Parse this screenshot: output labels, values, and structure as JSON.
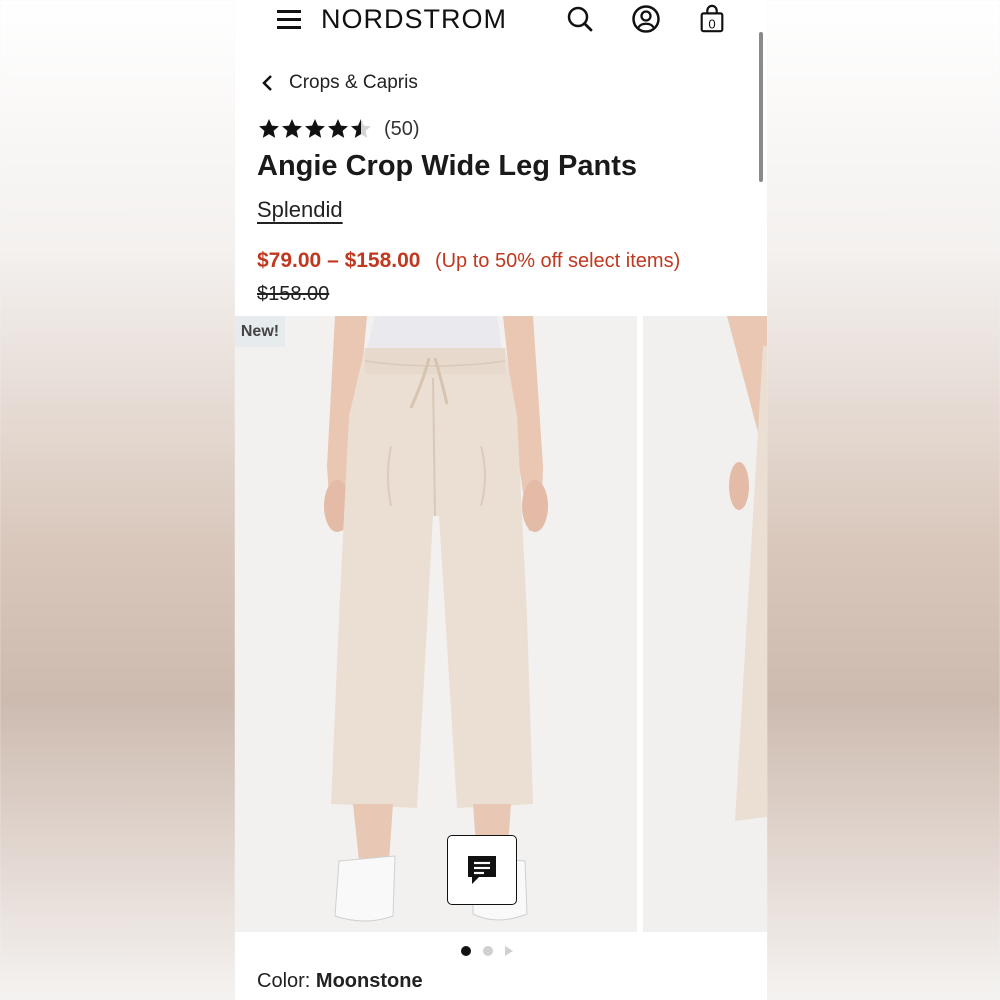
{
  "header": {
    "logo": "NORDSTROM",
    "menu_icon": "hamburger-menu-icon",
    "search_icon": "search-icon",
    "account_icon": "account-icon",
    "bag_icon": "shopping-bag-icon",
    "bag_count": "0"
  },
  "breadcrumb": {
    "label": "Crops & Capris",
    "icon": "chevron-left-icon"
  },
  "rating": {
    "stars": 4.5,
    "count": "(50)"
  },
  "product": {
    "title": "Angie Crop Wide Leg Pants",
    "brand": "Splendid",
    "price_range": "$79.00 – $158.00",
    "discount": "(Up to 50% off select items)",
    "original_price": "$158.00"
  },
  "gallery": {
    "badge": "New!",
    "current_slide": 1,
    "slide_count": 3
  },
  "color": {
    "label": "Color:",
    "value": "Moonstone"
  },
  "chat": {
    "icon": "chat-icon"
  },
  "colors": {
    "price_red": "#c0381f",
    "text": "#1a1a1a",
    "pants": "#e9dccf"
  }
}
